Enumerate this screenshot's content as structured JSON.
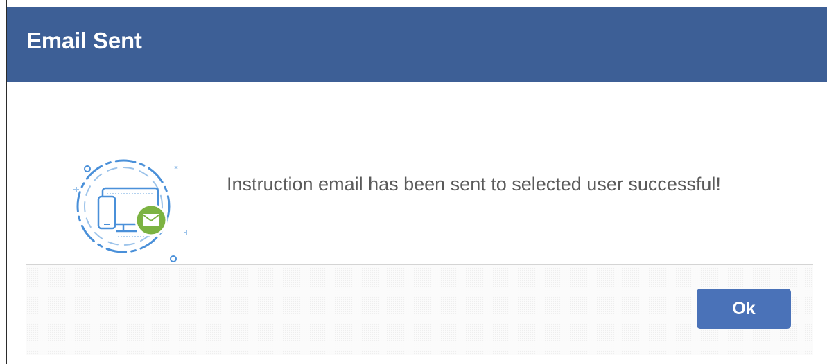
{
  "dialog": {
    "title": "Email Sent",
    "message": "Instruction email has been sent to selected user successful!",
    "ok_label": "Ok"
  },
  "icons": {
    "illustration": "email-devices-icon",
    "envelope": "envelope-icon"
  },
  "colors": {
    "header": "#3d5f96",
    "button": "#4a72b8",
    "envelope_badge": "#7cb342",
    "illustration_stroke": "#4a90d9"
  }
}
